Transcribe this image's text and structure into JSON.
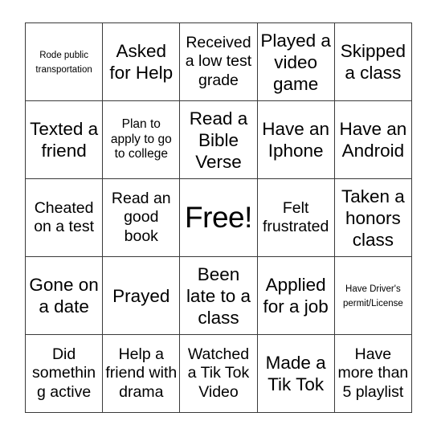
{
  "card": {
    "type": "bingo-card",
    "rows": 5,
    "columns": 5,
    "free_space_index": {
      "row": 2,
      "col": 2
    },
    "background_color": "#ffffff",
    "text_color": "#000000",
    "border_color": "#3a3a3a",
    "cells": [
      [
        {
          "text": "Rode public transportation",
          "size": "xs"
        },
        {
          "text": "Asked for Help",
          "size": "lg"
        },
        {
          "text": "Received a low test grade",
          "size": "md"
        },
        {
          "text": "Played a video game",
          "size": "lg"
        },
        {
          "text": "Skipped a class",
          "size": "lg"
        }
      ],
      [
        {
          "text": "Texted a friend",
          "size": "lg"
        },
        {
          "text": "Plan to apply to go to college",
          "size": "sm"
        },
        {
          "text": "Read a Bible Verse",
          "size": "lg"
        },
        {
          "text": "Have an Iphone",
          "size": "lg"
        },
        {
          "text": "Have an Android",
          "size": "lg"
        }
      ],
      [
        {
          "text": "Cheated on a test",
          "size": "md"
        },
        {
          "text": "Read an good book",
          "size": "md"
        },
        {
          "text": "Free!",
          "size": "free"
        },
        {
          "text": "Felt frustrated",
          "size": "md"
        },
        {
          "text": "Taken a honors class",
          "size": "lg"
        }
      ],
      [
        {
          "text": "Gone on a date",
          "size": "lg"
        },
        {
          "text": "Prayed",
          "size": "lg"
        },
        {
          "text": "Been late to a class",
          "size": "lg"
        },
        {
          "text": "Applied for a job",
          "size": "lg"
        },
        {
          "text": "Have Driver's permit/License",
          "size": "xs"
        }
      ],
      [
        {
          "text": "Did something active",
          "size": "md"
        },
        {
          "text": "Help a friend with drama",
          "size": "md"
        },
        {
          "text": "Watched a Tik Tok Video",
          "size": "md"
        },
        {
          "text": "Made a Tik Tok",
          "size": "lg"
        },
        {
          "text": "Have more than 5 playlist",
          "size": "md"
        }
      ]
    ]
  }
}
